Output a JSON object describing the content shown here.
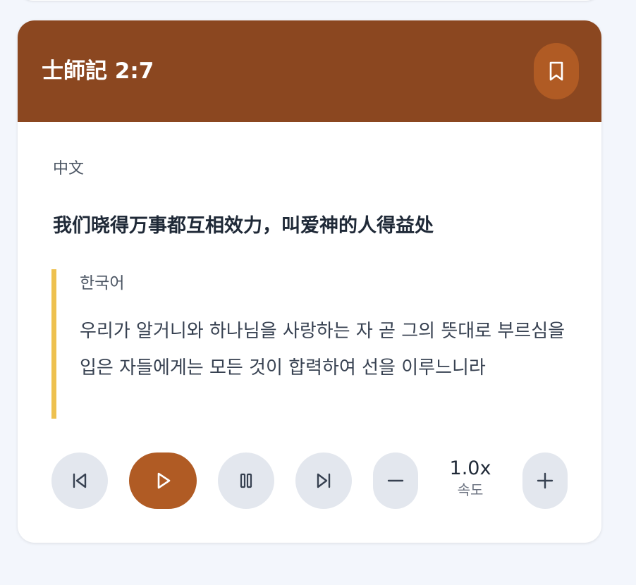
{
  "header": {
    "verse_reference": "士師記 2:7",
    "bookmark_icon": "bookmark-icon"
  },
  "chinese": {
    "label": "中文",
    "text": "我们晓得万事都互相效力，叫爱神的人得益处"
  },
  "korean": {
    "label": "한국어",
    "text": "우리가 알거니와 하나님을 사랑하는 자 곧 그의 뜻대로 부르심을 입은 자들에게는 모든 것이 합력하여 선을 이루느니라"
  },
  "player": {
    "buttons": [
      "skip-back-icon",
      "play-icon",
      "pause-icon",
      "skip-forward-icon",
      "minus-icon",
      "plus-icon"
    ],
    "speed_value": "1.0x",
    "speed_label": "속도"
  },
  "colors": {
    "header_bg": "#8b4720",
    "accent": "#b05b24",
    "quote_bar": "#eec14f",
    "button_bg": "#e3e7ee"
  }
}
